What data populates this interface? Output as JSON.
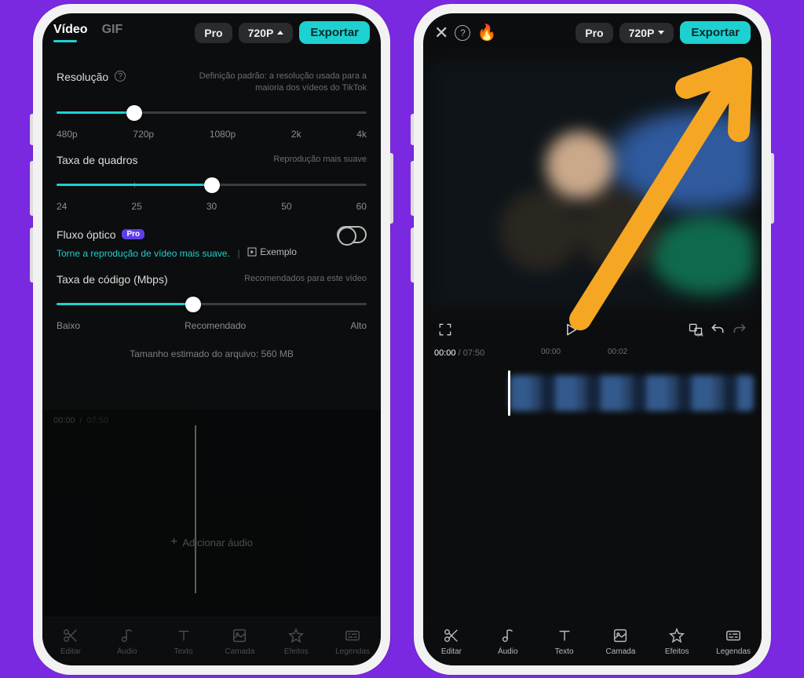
{
  "phone1": {
    "header": {
      "tab_video": "Vídeo",
      "tab_gif": "GIF",
      "pro_label": "Pro",
      "resolution_pill": "720P",
      "export_label": "Exportar"
    },
    "resolution": {
      "label": "Resolução",
      "hint": "Definição padrão: a resolução usada para a maioria dos vídeos do TikTok",
      "ticks": [
        "480p",
        "720p",
        "1080p",
        "2k",
        "4k"
      ]
    },
    "framerate": {
      "label": "Taxa de quadros",
      "hint": "Reprodução mais suave",
      "ticks": [
        "24",
        "25",
        "30",
        "50",
        "60"
      ]
    },
    "optical_flow": {
      "label": "Fluxo óptico",
      "sub": "Torne a reprodução de vídeo mais suave.",
      "example": "Exemplo"
    },
    "bitrate": {
      "label": "Taxa de código (Mbps)",
      "hint": "Recomendados para este vídeo",
      "ticks": [
        "Baixo",
        "Recomendado",
        "Alto"
      ]
    },
    "estimated": "Tamanho estimado do arquivo: 560 MB",
    "dim_editor": {
      "t1": "00:00",
      "t2": "07:50",
      "add_audio": "Adicionar áudio"
    }
  },
  "phone2": {
    "header": {
      "pro_label": "Pro",
      "resolution_pill": "720P",
      "export_label": "Exportar"
    },
    "time": {
      "current": "00:00",
      "duration": "07:50",
      "m1": "00:00",
      "m2": "00:02"
    }
  },
  "toolbar": {
    "edit": "Editar",
    "audio": "Áudio",
    "text": "Texto",
    "layer": "Camada",
    "effects": "Efeitos",
    "captions": "Legendas"
  }
}
